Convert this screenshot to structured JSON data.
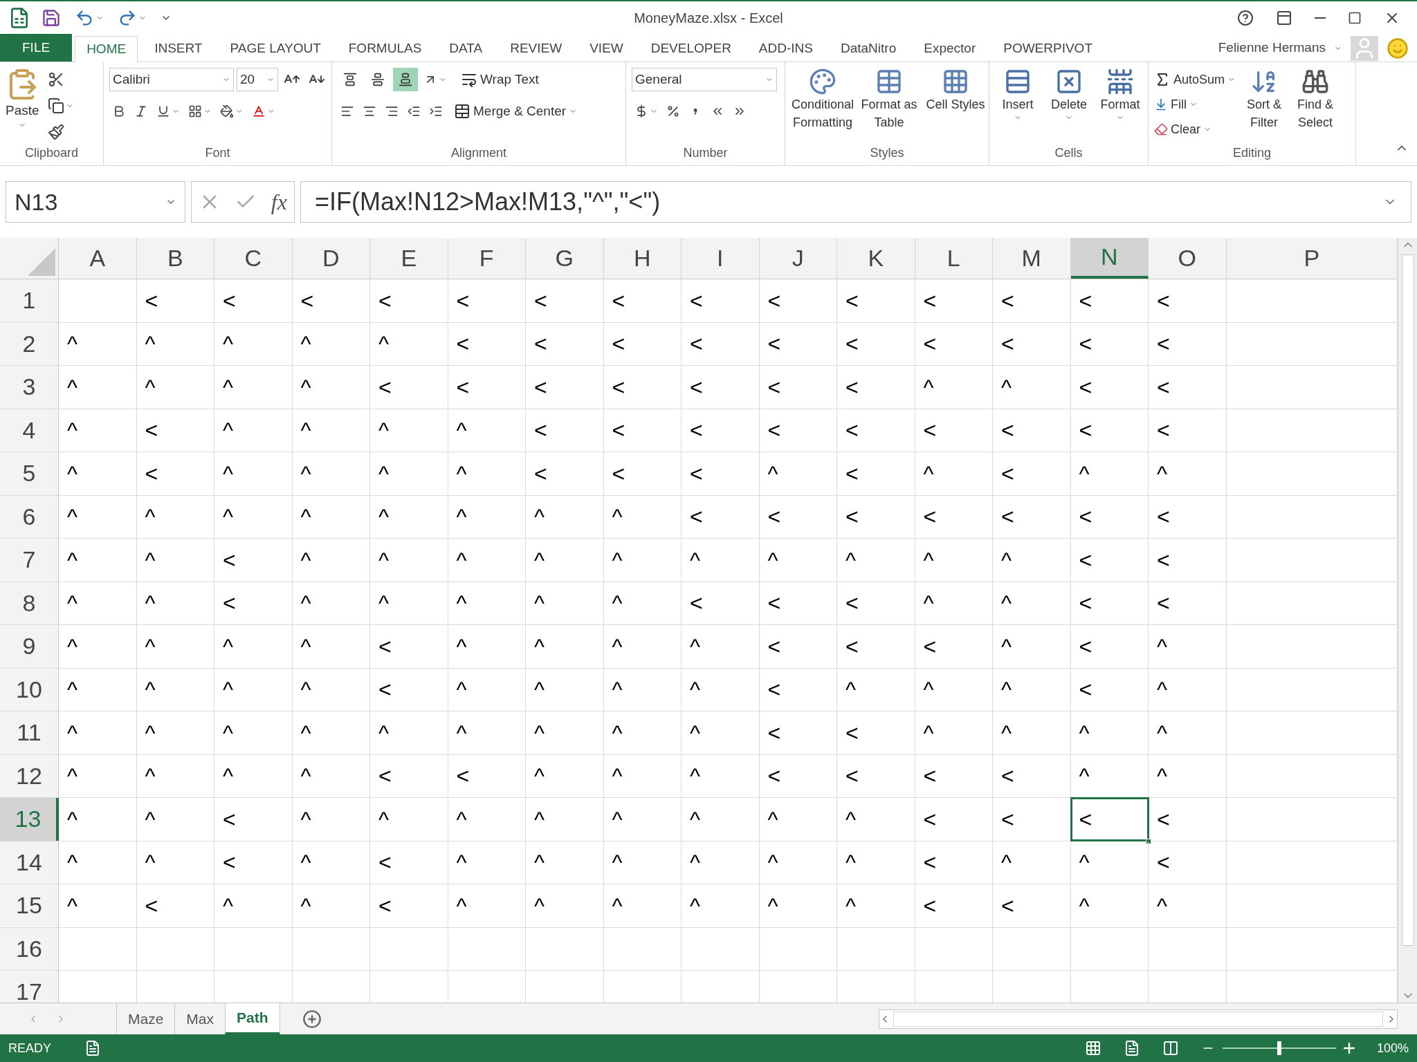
{
  "window": {
    "title": "MoneyMaze.xlsx - Excel"
  },
  "ribbon_tabs": [
    {
      "label": "FILE",
      "kind": "file",
      "selected": false
    },
    {
      "label": "HOME",
      "kind": "tab",
      "selected": true
    },
    {
      "label": "INSERT",
      "kind": "tab",
      "selected": false
    },
    {
      "label": "PAGE LAYOUT",
      "kind": "tab",
      "selected": false
    },
    {
      "label": "FORMULAS",
      "kind": "tab",
      "selected": false
    },
    {
      "label": "DATA",
      "kind": "tab",
      "selected": false
    },
    {
      "label": "REVIEW",
      "kind": "tab",
      "selected": false
    },
    {
      "label": "VIEW",
      "kind": "tab",
      "selected": false
    },
    {
      "label": "DEVELOPER",
      "kind": "tab",
      "selected": false
    },
    {
      "label": "ADD-INS",
      "kind": "tab",
      "selected": false
    },
    {
      "label": "DataNitro",
      "kind": "tab",
      "selected": false
    },
    {
      "label": "Expector",
      "kind": "tab",
      "selected": false
    },
    {
      "label": "POWERPIVOT",
      "kind": "tab",
      "selected": false
    }
  ],
  "user": {
    "name": "Felienne Hermans"
  },
  "ribbon": {
    "clipboard": {
      "paste": "Paste",
      "group": "Clipboard"
    },
    "font": {
      "name": "Calibri",
      "size": "20",
      "group": "Font"
    },
    "alignment": {
      "vertical": [
        {
          "selected": false
        },
        {
          "selected": false
        },
        {
          "selected": true
        }
      ],
      "wrap": "Wrap Text",
      "merge": "Merge & Center",
      "group": "Alignment"
    },
    "number": {
      "format": "General",
      "group": "Number"
    },
    "styles": {
      "buttons": [
        "Conditional Formatting",
        "Format as Table",
        "Cell Styles"
      ],
      "group": "Styles"
    },
    "cells": {
      "buttons": [
        "Insert",
        "Delete",
        "Format"
      ],
      "group": "Cells"
    },
    "editing": {
      "autosum": "AutoSum",
      "fill": "Fill",
      "clear": "Clear",
      "sort": "Sort & Filter",
      "find": "Find & Select",
      "group": "Editing"
    }
  },
  "formula_bar": {
    "name_box": "N13",
    "function_label": "fx",
    "formula": "=IF(Max!N12>Max!M13,\"^\",\"<\")"
  },
  "sheet": {
    "columns": [
      {
        "label": "A",
        "selected": false
      },
      {
        "label": "B",
        "selected": false
      },
      {
        "label": "C",
        "selected": false
      },
      {
        "label": "D",
        "selected": false
      },
      {
        "label": "E",
        "selected": false
      },
      {
        "label": "F",
        "selected": false
      },
      {
        "label": "G",
        "selected": false
      },
      {
        "label": "H",
        "selected": false
      },
      {
        "label": "I",
        "selected": false
      },
      {
        "label": "J",
        "selected": false
      },
      {
        "label": "K",
        "selected": false
      },
      {
        "label": "L",
        "selected": false
      },
      {
        "label": "M",
        "selected": false
      },
      {
        "label": "N",
        "selected": true
      },
      {
        "label": "O",
        "selected": false
      },
      {
        "label": "P",
        "selected": false
      }
    ],
    "rows": [
      {
        "label": "1",
        "selected": false,
        "cells": [
          null,
          "<",
          "<",
          "<",
          "<",
          "<",
          "<",
          "<",
          "<",
          "<",
          "<",
          "<",
          "<",
          "<",
          "<"
        ]
      },
      {
        "label": "2",
        "selected": false,
        "cells": [
          "^",
          "^",
          "^",
          "^",
          "^",
          "<",
          "<",
          "<",
          "<",
          "<",
          "<",
          "<",
          "<",
          "<",
          "<"
        ]
      },
      {
        "label": "3",
        "selected": false,
        "cells": [
          "^",
          "^",
          "^",
          "^",
          "<",
          "<",
          "<",
          "<",
          "<",
          "<",
          "<",
          "^",
          "^",
          "<",
          "<"
        ]
      },
      {
        "label": "4",
        "selected": false,
        "cells": [
          "^",
          "<",
          "^",
          "^",
          "^",
          "^",
          "<",
          "<",
          "<",
          "<",
          "<",
          "<",
          "<",
          "<",
          "<"
        ]
      },
      {
        "label": "5",
        "selected": false,
        "cells": [
          "^",
          "<",
          "^",
          "^",
          "^",
          "^",
          "<",
          "<",
          "<",
          "^",
          "<",
          "^",
          "<",
          "^",
          "^"
        ]
      },
      {
        "label": "6",
        "selected": false,
        "cells": [
          "^",
          "^",
          "^",
          "^",
          "^",
          "^",
          "^",
          "^",
          "<",
          "<",
          "<",
          "<",
          "<",
          "<",
          "<"
        ]
      },
      {
        "label": "7",
        "selected": false,
        "cells": [
          "^",
          "^",
          "<",
          "^",
          "^",
          "^",
          "^",
          "^",
          "^",
          "^",
          "^",
          "^",
          "^",
          "<",
          "<"
        ]
      },
      {
        "label": "8",
        "selected": false,
        "cells": [
          "^",
          "^",
          "<",
          "^",
          "^",
          "^",
          "^",
          "^",
          "<",
          "<",
          "<",
          "^",
          "^",
          "<",
          "<"
        ]
      },
      {
        "label": "9",
        "selected": false,
        "cells": [
          "^",
          "^",
          "^",
          "^",
          "<",
          "^",
          "^",
          "^",
          "^",
          "<",
          "<",
          "<",
          "^",
          "<",
          "^"
        ]
      },
      {
        "label": "10",
        "selected": false,
        "cells": [
          "^",
          "^",
          "^",
          "^",
          "<",
          "^",
          "^",
          "^",
          "^",
          "<",
          "^",
          "^",
          "^",
          "<",
          "^"
        ]
      },
      {
        "label": "11",
        "selected": false,
        "cells": [
          "^",
          "^",
          "^",
          "^",
          "^",
          "^",
          "^",
          "^",
          "^",
          "<",
          "<",
          "^",
          "^",
          "^",
          "^"
        ]
      },
      {
        "label": "12",
        "selected": false,
        "cells": [
          "^",
          "^",
          "^",
          "^",
          "<",
          "<",
          "^",
          "^",
          "^",
          "<",
          "<",
          "<",
          "<",
          "^",
          "^"
        ]
      },
      {
        "label": "13",
        "selected": true,
        "cells": [
          "^",
          "^",
          "<",
          "^",
          "^",
          "^",
          "^",
          "^",
          "^",
          "^",
          "^",
          "<",
          "<",
          "<",
          "<"
        ]
      },
      {
        "label": "14",
        "selected": false,
        "cells": [
          "^",
          "^",
          "<",
          "^",
          "<",
          "^",
          "^",
          "^",
          "^",
          "^",
          "^",
          "<",
          "^",
          "^",
          "<"
        ]
      },
      {
        "label": "15",
        "selected": false,
        "cells": [
          "^",
          "<",
          "^",
          "^",
          "<",
          "^",
          "^",
          "^",
          "^",
          "^",
          "^",
          "<",
          "<",
          "^",
          "^"
        ]
      },
      {
        "label": "16",
        "selected": false
      },
      {
        "label": "17",
        "selected": false
      }
    ]
  },
  "sheet_tabs": [
    {
      "label": "Maze",
      "selected": false
    },
    {
      "label": "Max",
      "selected": false
    },
    {
      "label": "Path",
      "selected": true
    }
  ],
  "status_bar": {
    "mode": "READY",
    "zoom": "100%",
    "zoom_slider": {
      "level": 0.5
    }
  }
}
